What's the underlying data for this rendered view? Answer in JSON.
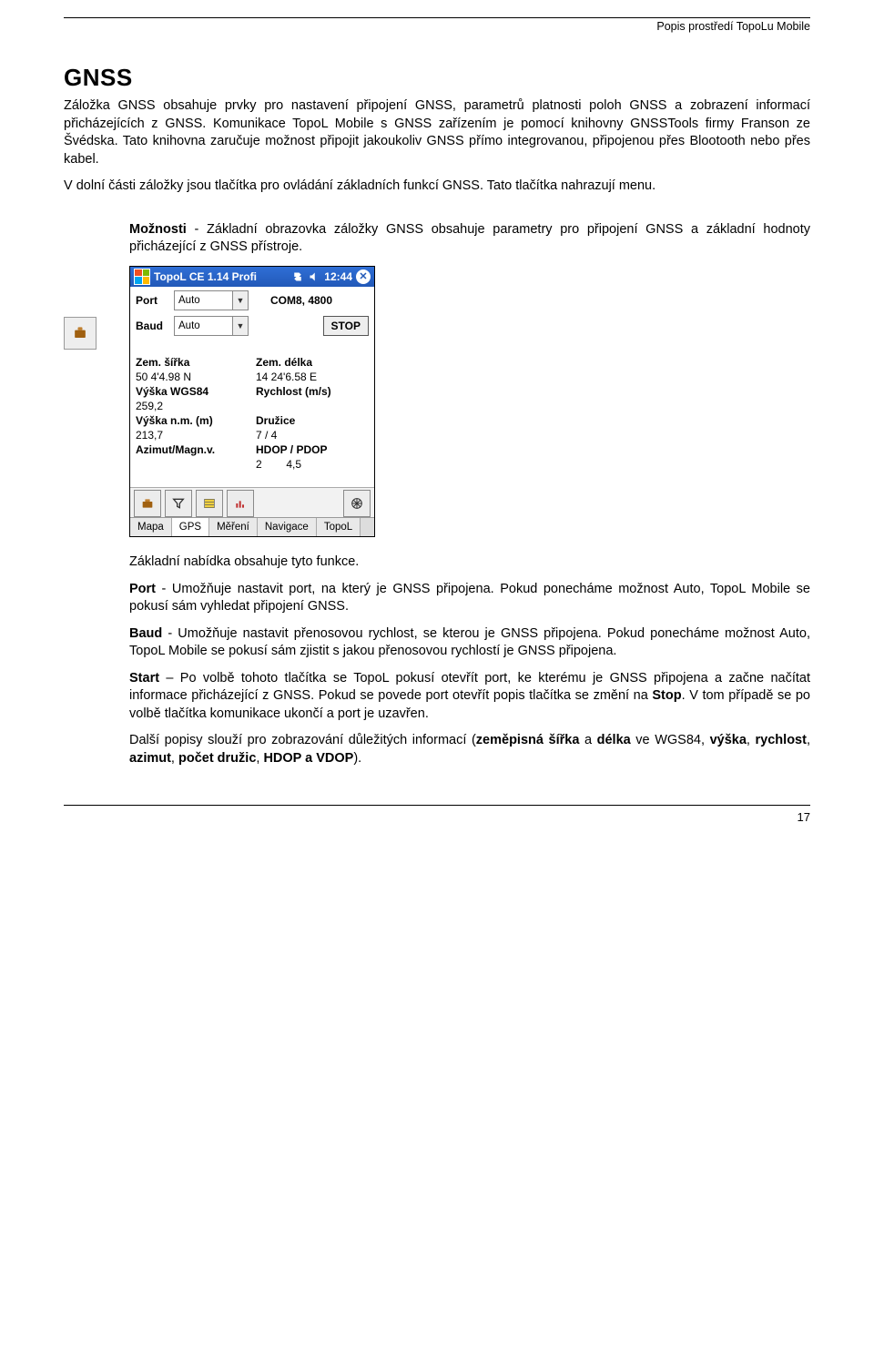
{
  "header": {
    "caption": "Popis prostředí TopoLu Mobile"
  },
  "title": "GNSS",
  "paragraphs": {
    "intro1": "Záložka GNSS obsahuje prvky pro nastavení připojení GNSS, parametrů platnosti poloh GNSS a zobrazení informací přicházejících z GNSS. Komunikace TopoL Mobile s GNSS zařízením je pomocí knihovny GNSSTools firmy Franson ze Švédska. Tato knihovna zaručuje možnost připojit jakoukoliv GNSS přímo integrovanou, připojenou přes Blootooth nebo přes kabel.",
    "intro2": "V dolní části záložky jsou tlačítka pro ovládání základních funkcí GNSS. Tato tlačítka nahrazují menu.",
    "moznosti_label": "Možnosti",
    "moznosti_text": " - Základní obrazovka záložky GNSS obsahuje parametry pro připojení GNSS a základní hodnoty přicházející z GNSS přístroje.",
    "nabidka": "Základní nabídka obsahuje tyto funkce.",
    "port_label": "Port",
    "port_text": " - Umožňuje nastavit port, na který je GNSS připojena.  Pokud ponecháme možnost Auto, TopoL Mobile se pokusí sám vyhledat připojení GNSS.",
    "baud_label": "Baud",
    "baud_text": " - Umožňuje nastavit přenosovou rychlost, se kterou je GNSS připojena. Pokud ponecháme možnost Auto, TopoL Mobile se pokusí sám zjistit s jakou přenosovou rychlostí je GNSS připojena.",
    "start_label": "Start",
    "start_text_a": " – Po volbě tohoto tlačítka se TopoL pokusí otevřít port, ke kterému je GNSS připojena a začne načítat informace přicházející z GNSS. Pokud se povede port otevřít popis tlačítka se změní na ",
    "start_stop": "Stop",
    "start_text_b": ". V tom případě se po volbě tlačítka komunikace ukončí a port je uzavřen.",
    "dalsi_a": "Další popisy slouží pro zobrazování důležitých informací (",
    "dalsi_b_1": "zeměpisná šířka",
    "dalsi_and": " a ",
    "dalsi_b_2": "délka",
    "dalsi_c": " ve WGS84, ",
    "dalsi_d_1": "výška",
    "dalsi_sep1": ", ",
    "dalsi_d_2": "rychlost",
    "dalsi_sep2": ", ",
    "dalsi_d_3": "azimut",
    "dalsi_sep3": ", ",
    "dalsi_d_4": "počet družic",
    "dalsi_sep4": ", ",
    "dalsi_d_5": "HDOP a VDOP",
    "dalsi_e": ")."
  },
  "app": {
    "title": "TopoL CE 1.14 Profi",
    "clock": "12:44",
    "port_label": "Port",
    "port_value": "Auto",
    "port_readout": "COM8, 4800",
    "baud_label": "Baud",
    "baud_value": "Auto",
    "stop": "STOP",
    "fields": [
      {
        "h": "Zem. šířka",
        "v": "50 4'4.98 N"
      },
      {
        "h": "Zem. délka",
        "v": "14 24'6.58 E"
      },
      {
        "h": "Výška WGS84",
        "v": "259,2"
      },
      {
        "h": "Rychlost (m/s)",
        "v": ""
      },
      {
        "h": "Výška n.m. (m)",
        "v": "213,7"
      },
      {
        "h": "Družice",
        "v": "7 / 4"
      },
      {
        "h": "Azimut/Magn.v.",
        "v": ""
      },
      {
        "h": "HDOP / PDOP",
        "v": "2        4,5"
      }
    ],
    "tabs": [
      "Mapa",
      "GPS",
      "Měření",
      "Navigace",
      "TopoL"
    ]
  },
  "page_number": "17"
}
